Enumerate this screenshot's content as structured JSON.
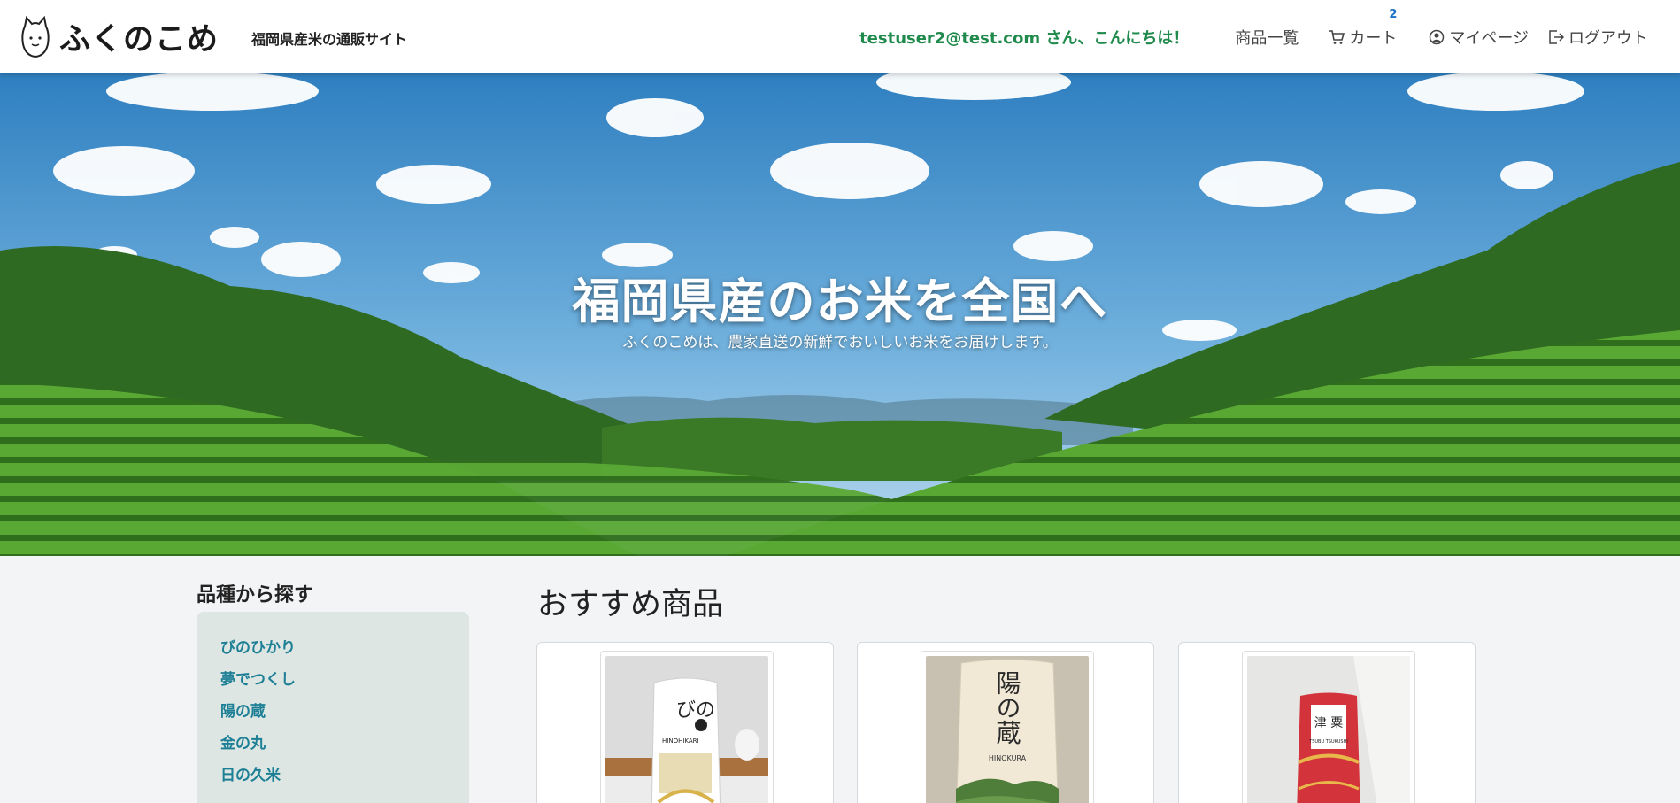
{
  "header": {
    "logo_text": "ふくのこめ",
    "tagline": "福岡県産米の通販サイト",
    "greeting": "testuser2@test.com さん、こんにちは！",
    "nav": {
      "products": "商品一覧",
      "cart": "カート",
      "cart_count": "2",
      "mypage": "マイページ",
      "logout": "ログアウト"
    }
  },
  "hero": {
    "title": "福岡県産のお米を全国へ",
    "subtitle": "ふくのこめは、農家直送の新鮮でおいしいお米をお届けします。"
  },
  "sidebar": {
    "title": "品種から探す",
    "items": [
      "びのひかり",
      "夢でつくし",
      "陽の蔵",
      "金の丸",
      "日の久米"
    ]
  },
  "main": {
    "title": "おすすめ商品",
    "products": [
      {
        "pkg_top": "びの",
        "pkg_brand": "HINOHIKARI",
        "pkg_color": "#ffffff"
      },
      {
        "pkg_top": "陽の蔵",
        "pkg_brand": "HINOKURA",
        "pkg_color": "#f1e9d6"
      },
      {
        "pkg_top": "津 粟",
        "pkg_brand": "TSUBU TSUKUSHI",
        "pkg_color": "#d3343c"
      }
    ]
  },
  "colors": {
    "accent_green": "#1f8a4c",
    "link_teal": "#1d7f95",
    "badge_blue": "#1a73c8"
  }
}
